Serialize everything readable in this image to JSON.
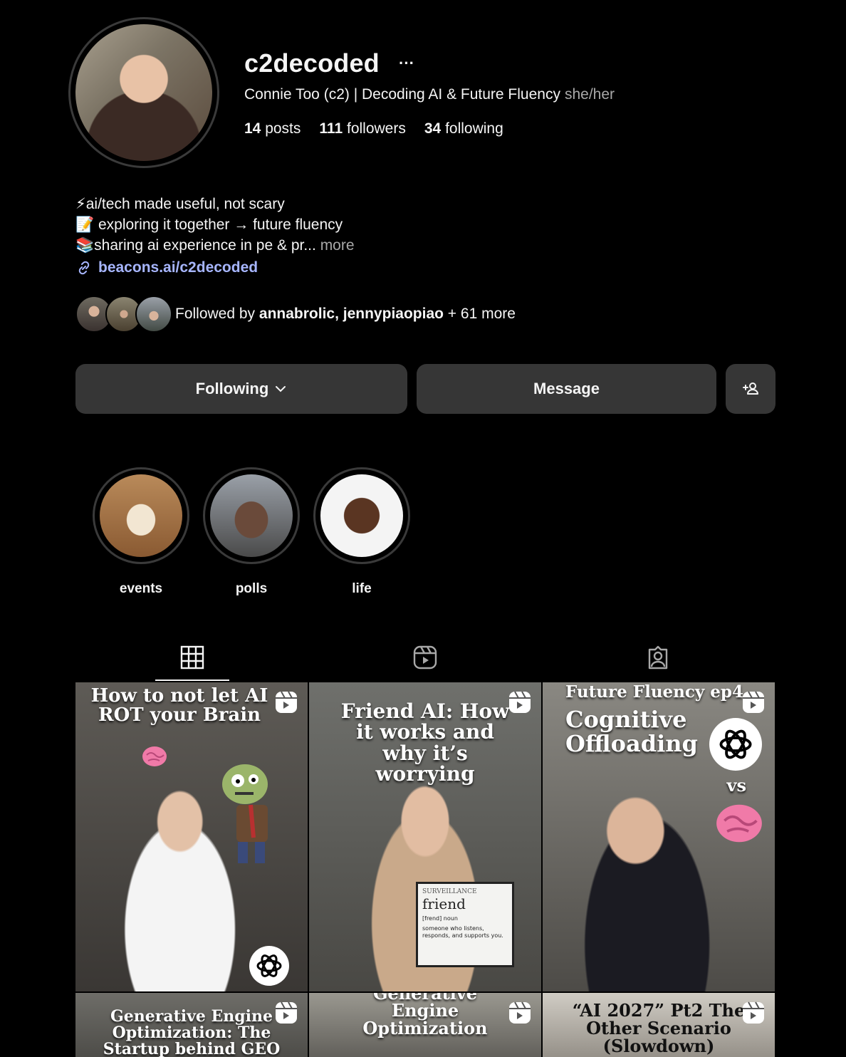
{
  "profile": {
    "username": "c2decoded",
    "more": "···",
    "full_name": "Connie Too (c2) | Decoding AI & Future Fluency",
    "pronouns": "she/her",
    "stats": {
      "posts_count": "14",
      "posts_label": "posts",
      "followers_count": "111",
      "followers_label": "followers",
      "following_count": "34",
      "following_label": "following"
    },
    "bio": {
      "line1": "⚡ai/tech made useful, not scary",
      "line2": "📝 exploring it together → future fluency",
      "line3": "📚sharing ai experience in pe & pr...",
      "more": "more"
    },
    "link": "beacons.ai/c2decoded",
    "followed_by": {
      "prefix": "Followed by",
      "names": "annabrolic, jennypiaopiao",
      "suffix": "+ 61 more"
    }
  },
  "actions": {
    "following": "Following",
    "message": "Message"
  },
  "highlights": [
    {
      "label": "events"
    },
    {
      "label": "polls"
    },
    {
      "label": "life"
    }
  ],
  "tabs": [
    {
      "icon": "grid-icon",
      "active": true
    },
    {
      "icon": "reels-icon",
      "active": false
    },
    {
      "icon": "tagged-icon",
      "active": false
    }
  ],
  "posts": [
    {
      "caption": "How to not let AI ROT your Brain",
      "type": "reel"
    },
    {
      "caption": "Friend AI: How it works and why it’s worrying",
      "type": "reel",
      "card_word": "friend",
      "card_pos": "[frend] noun",
      "card_def": "someone who listens, responds, and supports you.",
      "card_scrawl": "SURVEILLANCE"
    },
    {
      "caption_top": "Future Fluency ep4",
      "caption": "Cognitive Offloading",
      "vs": "vs",
      "type": "reel"
    },
    {
      "caption": "Generative Engine Optimization: The Startup behind GEO",
      "type": "reel"
    },
    {
      "caption_top": "Generative",
      "caption": "Engine Optimization",
      "type": "reel"
    },
    {
      "caption": "“AI 2027” Pt2 The Other Scenario (Slowdown)",
      "type": "reel"
    }
  ]
}
